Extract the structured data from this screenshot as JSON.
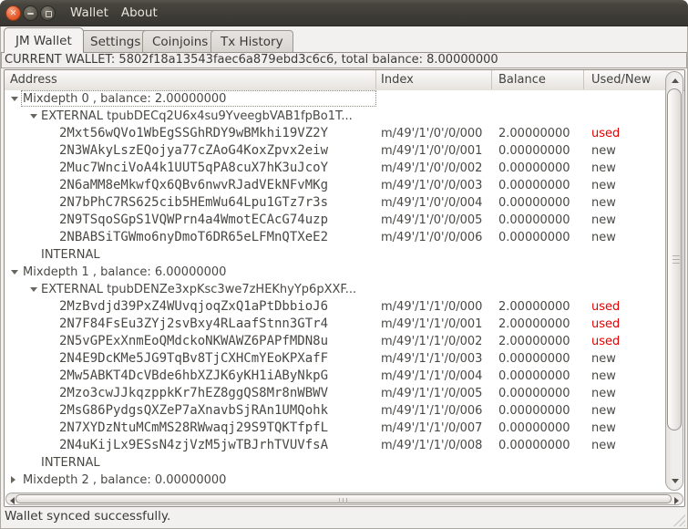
{
  "titlebar": {
    "menu_items": [
      "Wallet",
      "About"
    ],
    "buttons": [
      "close",
      "minimize",
      "maximize"
    ]
  },
  "tabs": [
    {
      "label": "JM Wallet",
      "active": true
    },
    {
      "label": "Settings",
      "active": false
    },
    {
      "label": "Coinjoins",
      "active": false
    },
    {
      "label": "Tx History",
      "active": false
    }
  ],
  "wallet_header": "CURRENT WALLET: 5802f18a13543faec6a879ebd3c6c6, total balance: 8.00000000",
  "table": {
    "columns": [
      "Address",
      "Index",
      "Balance",
      "Used/New"
    ],
    "rows": [
      {
        "type": "mixdepth",
        "expanded": true,
        "focused": true,
        "label": "Mixdepth 0 , balance: 2.00000000"
      },
      {
        "type": "branch",
        "expanded": true,
        "label": "EXTERNAL tpubDECq2U6x4su9YveegbVAB1fpBo1T..."
      },
      {
        "type": "address",
        "address": "2Mxt56wQVo1WbEgSSGhRDY9wBMkhi19VZ2Y",
        "index": "m/49'/1'/0'/0/000",
        "balance": "2.00000000",
        "status": "used"
      },
      {
        "type": "address",
        "address": "2N3WAkyLszEQojya77cZAoG4KoxZpvx2eiw",
        "index": "m/49'/1'/0'/0/001",
        "balance": "0.00000000",
        "status": "new"
      },
      {
        "type": "address",
        "address": "2Muc7WnciVoA4k1UUT5qPA8cuX7hK3uJcoY",
        "index": "m/49'/1'/0'/0/002",
        "balance": "0.00000000",
        "status": "new"
      },
      {
        "type": "address",
        "address": "2N6aMM8eMkwfQx6QBv6nwvRJadVEkNFvMKg",
        "index": "m/49'/1'/0'/0/003",
        "balance": "0.00000000",
        "status": "new"
      },
      {
        "type": "address",
        "address": "2N7bPhC7RS625cib5HEmWu64Lpu1GTz7r3s",
        "index": "m/49'/1'/0'/0/004",
        "balance": "0.00000000",
        "status": "new"
      },
      {
        "type": "address",
        "address": "2N9TSqoSGpS1VQWPrn4a4WmotECAcG74uzp",
        "index": "m/49'/1'/0'/0/005",
        "balance": "0.00000000",
        "status": "new"
      },
      {
        "type": "address",
        "address": "2NBABSiTGWmo6nyDmoT6DR65eLFMnQTXeE2",
        "index": "m/49'/1'/0'/0/006",
        "balance": "0.00000000",
        "status": "new"
      },
      {
        "type": "internal",
        "label": "INTERNAL"
      },
      {
        "type": "mixdepth",
        "expanded": true,
        "label": "Mixdepth 1 , balance: 6.00000000"
      },
      {
        "type": "branch",
        "expanded": true,
        "label": "EXTERNAL tpubDENZe3xpKsc3we7zHEKhyYp6pXXF..."
      },
      {
        "type": "address",
        "address": "2MzBvdjd39PxZ4WUvqjoqZxQ1aPtDbbioJ6",
        "index": "m/49'/1'/1'/0/000",
        "balance": "2.00000000",
        "status": "used"
      },
      {
        "type": "address",
        "address": "2N7F84FsEu3ZYj2svBxy4RLaafStnn3GTr4",
        "index": "m/49'/1'/1'/0/001",
        "balance": "2.00000000",
        "status": "used"
      },
      {
        "type": "address",
        "address": "2N5vGPExXnmEoQMdckoNKWAWZ6PAPfMDN8u",
        "index": "m/49'/1'/1'/0/002",
        "balance": "2.00000000",
        "status": "used"
      },
      {
        "type": "address",
        "address": "2N4E9DcKMe5JG9TqBv8TjCXHCmYEoKPXafF",
        "index": "m/49'/1'/1'/0/003",
        "balance": "0.00000000",
        "status": "new"
      },
      {
        "type": "address",
        "address": "2Mw5ABKT4DcVBde6hbXZJK6yKH1iAByNkpG",
        "index": "m/49'/1'/1'/0/004",
        "balance": "0.00000000",
        "status": "new"
      },
      {
        "type": "address",
        "address": "2Mzo3cwJJkqzppkKr7hEZ8ggQS8Mr8nWBWV",
        "index": "m/49'/1'/1'/0/005",
        "balance": "0.00000000",
        "status": "new"
      },
      {
        "type": "address",
        "address": "2MsG86PydgsQXZeP7aXnavbSjRAn1UMQohk",
        "index": "m/49'/1'/1'/0/006",
        "balance": "0.00000000",
        "status": "new"
      },
      {
        "type": "address",
        "address": "2N7XYDzNtuMCmMS28RWwaqj29S9TQKTfpfL",
        "index": "m/49'/1'/1'/0/007",
        "balance": "0.00000000",
        "status": "new"
      },
      {
        "type": "address",
        "address": "2N4uKijLx9ESsN4zjVzM5jwTBJrhTVUVfsA",
        "index": "m/49'/1'/1'/0/008",
        "balance": "0.00000000",
        "status": "new"
      },
      {
        "type": "internal",
        "label": "INTERNAL"
      },
      {
        "type": "mixdepth",
        "expanded": false,
        "label": "Mixdepth 2 , balance: 0.00000000"
      }
    ]
  },
  "status_bar": {
    "message": "Wallet synced successfully."
  },
  "colors": {
    "used_text": "#e60000",
    "new_text": "#4a4845",
    "close_button": "#e0552e",
    "titlebar_bg": "#3d3b36",
    "selection_focus": "#8d8a84"
  }
}
